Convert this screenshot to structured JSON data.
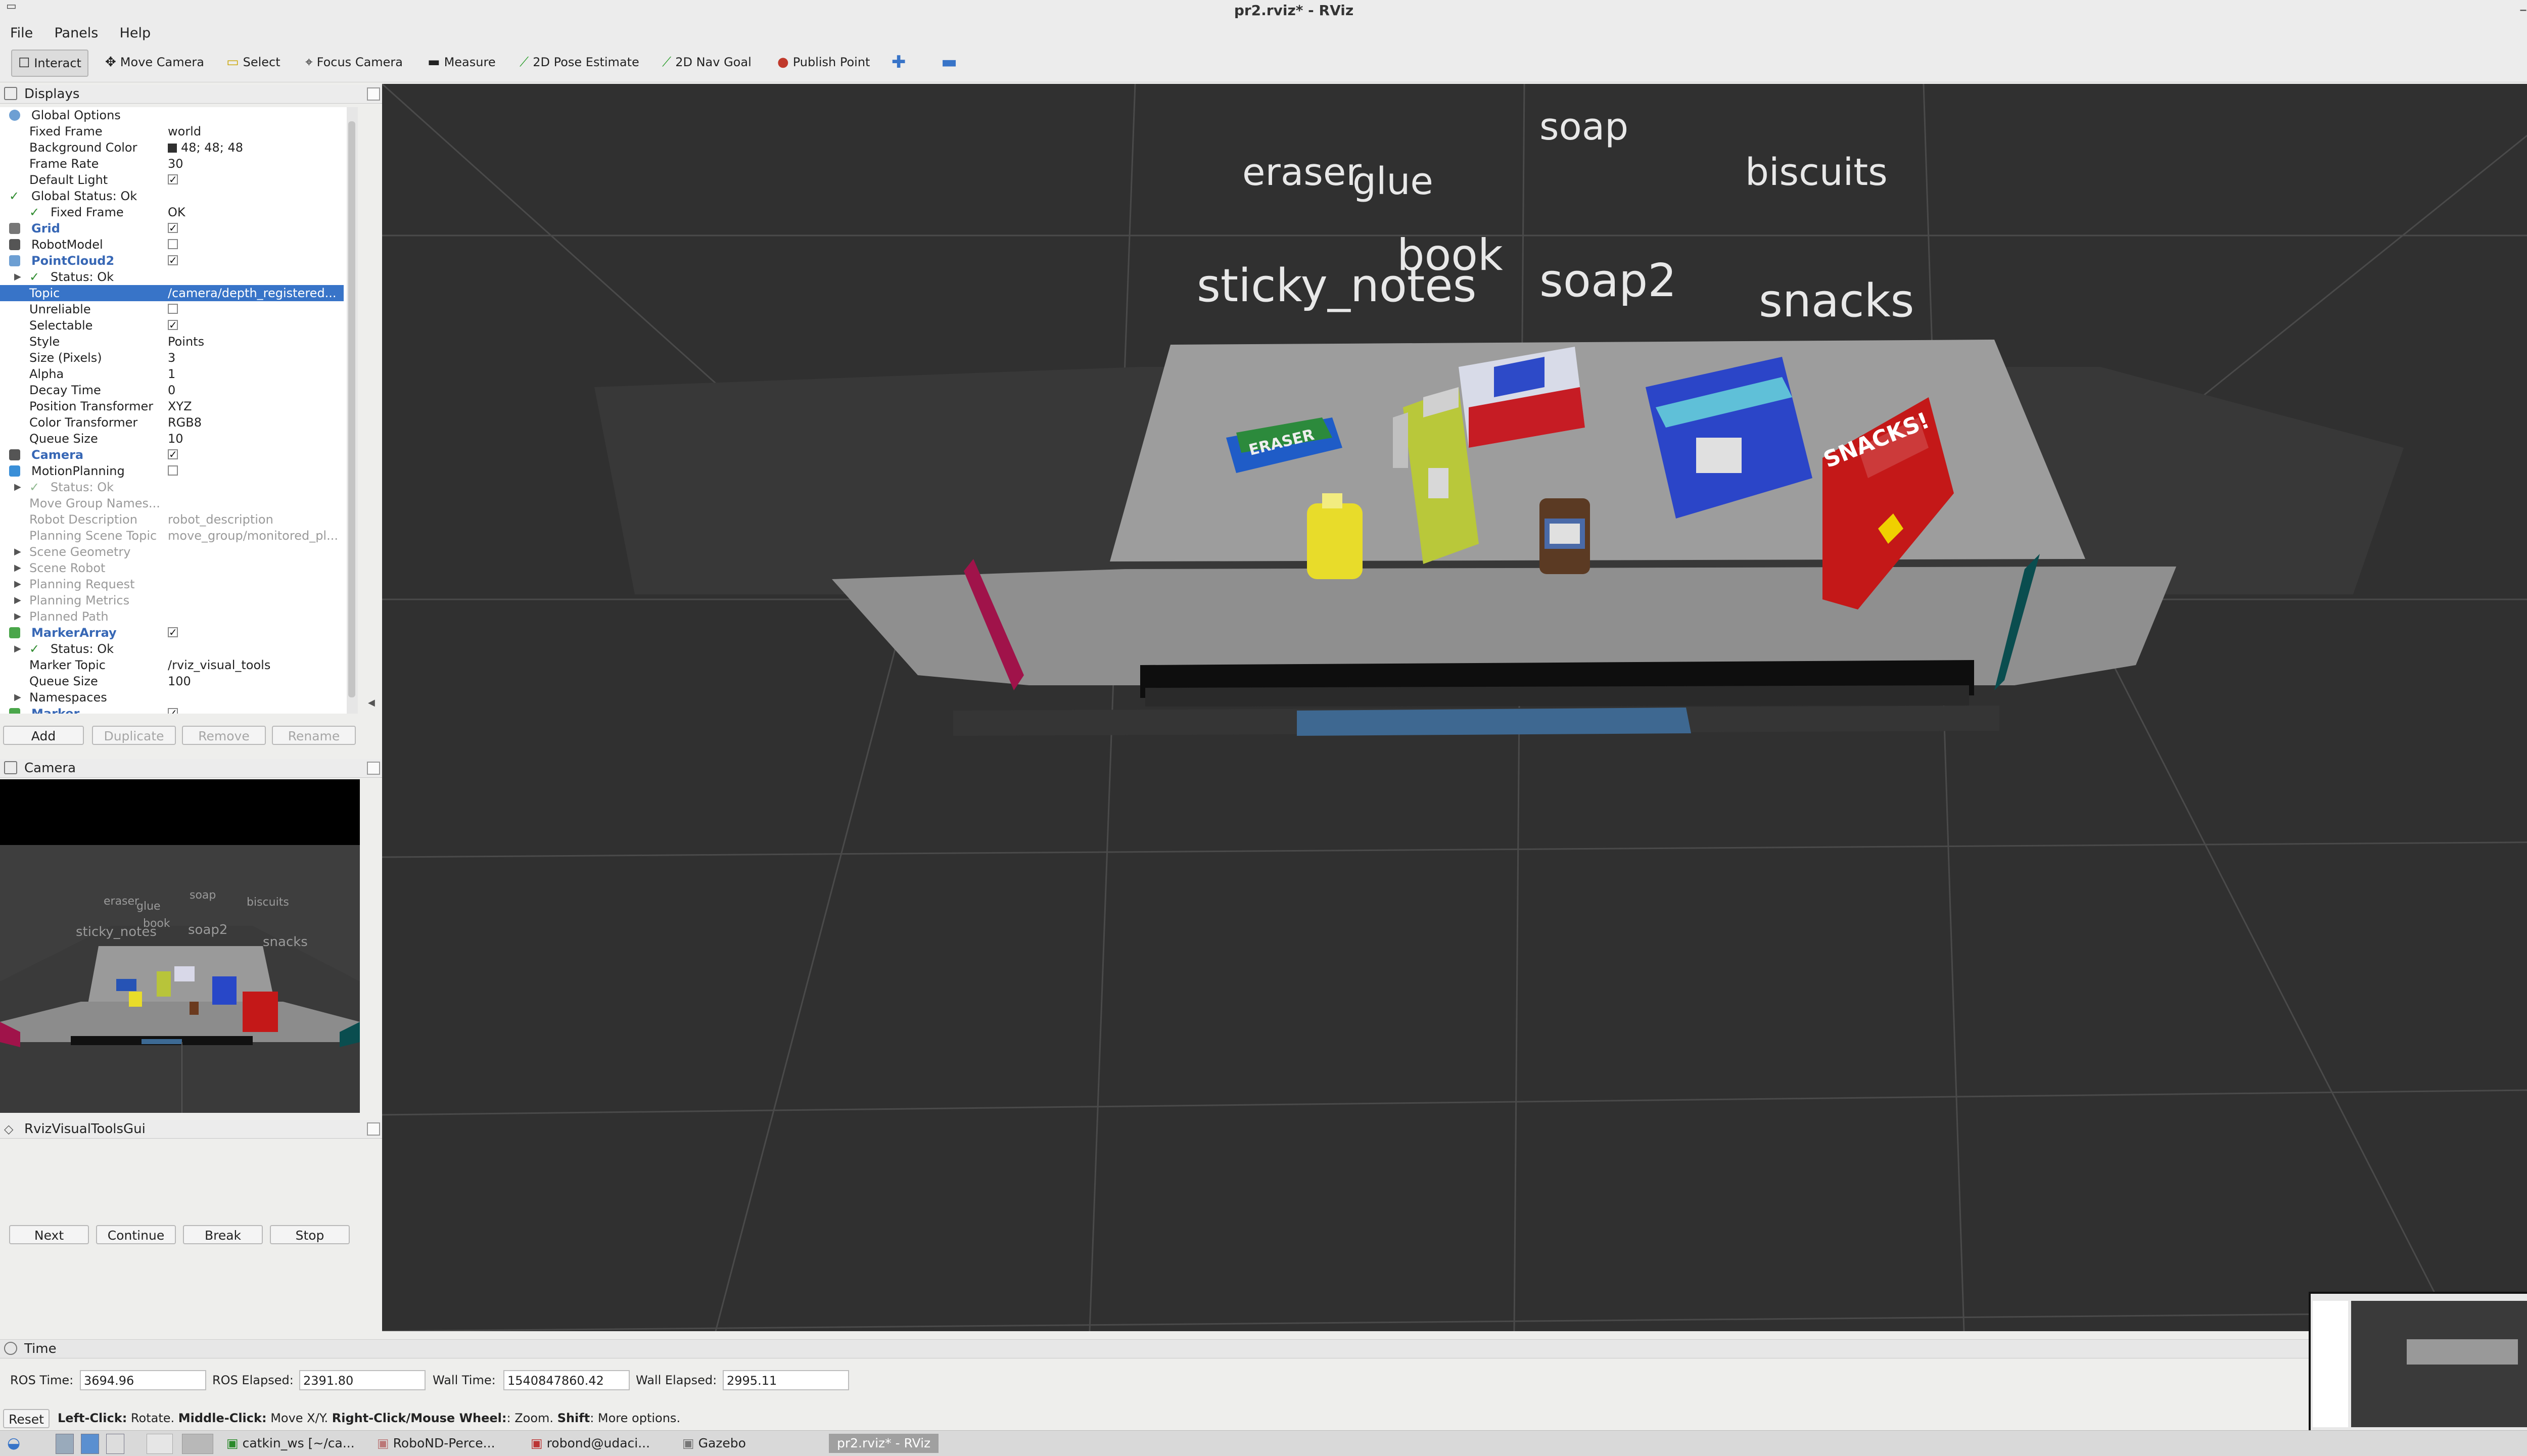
{
  "window": {
    "title": "pr2.rviz* - RViz"
  },
  "menu": [
    "File",
    "Panels",
    "Help"
  ],
  "toolbar": {
    "interact": "Interact",
    "move_camera": "Move Camera",
    "select": "Select",
    "focus_camera": "Focus Camera",
    "measure": "Measure",
    "pose_estimate": "2D Pose Estimate",
    "nav_goal": "2D Nav Goal",
    "publish_point": "Publish Point"
  },
  "displays_panel": {
    "title": "Displays",
    "rows": [
      {
        "name": "Global Options",
        "value": ""
      },
      {
        "name": "Fixed Frame",
        "value": "world"
      },
      {
        "name": "Background Color",
        "value": "48; 48; 48"
      },
      {
        "name": "Frame Rate",
        "value": "30"
      },
      {
        "name": "Default Light",
        "value": ""
      },
      {
        "name": "Global Status: Ok",
        "value": ""
      },
      {
        "name": "Fixed Frame",
        "value": "OK"
      },
      {
        "name": "Grid",
        "value": ""
      },
      {
        "name": "RobotModel",
        "value": ""
      },
      {
        "name": "PointCloud2",
        "value": ""
      },
      {
        "name": "Status: Ok",
        "value": ""
      },
      {
        "name": "Topic",
        "value": "/camera/depth_registered..."
      },
      {
        "name": "Unreliable",
        "value": ""
      },
      {
        "name": "Selectable",
        "value": ""
      },
      {
        "name": "Style",
        "value": "Points"
      },
      {
        "name": "Size (Pixels)",
        "value": "3"
      },
      {
        "name": "Alpha",
        "value": "1"
      },
      {
        "name": "Decay Time",
        "value": "0"
      },
      {
        "name": "Position Transformer",
        "value": "XYZ"
      },
      {
        "name": "Color Transformer",
        "value": "RGB8"
      },
      {
        "name": "Queue Size",
        "value": "10"
      },
      {
        "name": "Camera",
        "value": ""
      },
      {
        "name": "MotionPlanning",
        "value": ""
      },
      {
        "name": "Status: Ok",
        "value": ""
      },
      {
        "name": "Move Group Names...",
        "value": ""
      },
      {
        "name": "Robot Description",
        "value": "robot_description"
      },
      {
        "name": "Planning Scene Topic",
        "value": "move_group/monitored_pl..."
      },
      {
        "name": "Scene Geometry",
        "value": ""
      },
      {
        "name": "Scene Robot",
        "value": ""
      },
      {
        "name": "Planning Request",
        "value": ""
      },
      {
        "name": "Planning Metrics",
        "value": ""
      },
      {
        "name": "Planned Path",
        "value": ""
      },
      {
        "name": "MarkerArray",
        "value": ""
      },
      {
        "name": "Status: Ok",
        "value": ""
      },
      {
        "name": "Marker Topic",
        "value": "/rviz_visual_tools"
      },
      {
        "name": "Queue Size",
        "value": "100"
      },
      {
        "name": "Namespaces",
        "value": ""
      },
      {
        "name": "Marker",
        "value": ""
      }
    ],
    "buttons": {
      "add": "Add",
      "duplicate": "Duplicate",
      "remove": "Remove",
      "rename": "Rename"
    }
  },
  "camera_panel": {
    "title": "Camera",
    "labels": {
      "eraser": "eraser",
      "glue": "glue",
      "soap": "soap",
      "biscuits": "biscuits",
      "book": "book",
      "sticky_notes": "sticky_notes",
      "soap2": "soap2",
      "snacks": "snacks"
    }
  },
  "rviz_visual_tools_panel": {
    "title": "RvizVisualToolsGui",
    "buttons": {
      "next": "Next",
      "continue": "Continue",
      "break": "Break",
      "stop": "Stop"
    }
  },
  "viewport": {
    "labels": {
      "soap": "soap",
      "eraser": "eraser",
      "glue": "glue",
      "biscuits": "biscuits",
      "book": "book",
      "sticky_notes": "sticky_notes",
      "soap2": "soap2",
      "snacks": "snacks"
    },
    "object_texts": {
      "eraser_box": "ERASER",
      "snacks_box": "SNACKS!"
    }
  },
  "time_panel": {
    "title": "Time",
    "ros_time_label": "ROS Time:",
    "ros_time": "3694.96",
    "ros_elapsed_label": "ROS Elapsed:",
    "ros_elapsed": "2391.80",
    "wall_time_label": "Wall Time:",
    "wall_time": "1540847860.42",
    "wall_elapsed_label": "Wall Elapsed:",
    "wall_elapsed": "2995.11"
  },
  "status_bar": {
    "reset": "Reset",
    "hint_left": "Left-Click:",
    "hint_left_text": " Rotate. ",
    "hint_middle": "Middle-Click:",
    "hint_middle_text": " Move X/Y. ",
    "hint_right": "Right-Click/Mouse Wheel:",
    "hint_right_text": ": Zoom. ",
    "hint_shift": "Shift",
    "hint_shift_text": ": More options."
  },
  "taskbar": {
    "items": [
      "catkin_ws [~/ca...",
      "RoboND-Perce...",
      "robond@udaci...",
      "Gazebo",
      "pr2.rviz* - RViz"
    ]
  },
  "colors": {
    "background": "#303030",
    "selection": "#3874c8",
    "accent_blue": "#3767b5"
  }
}
